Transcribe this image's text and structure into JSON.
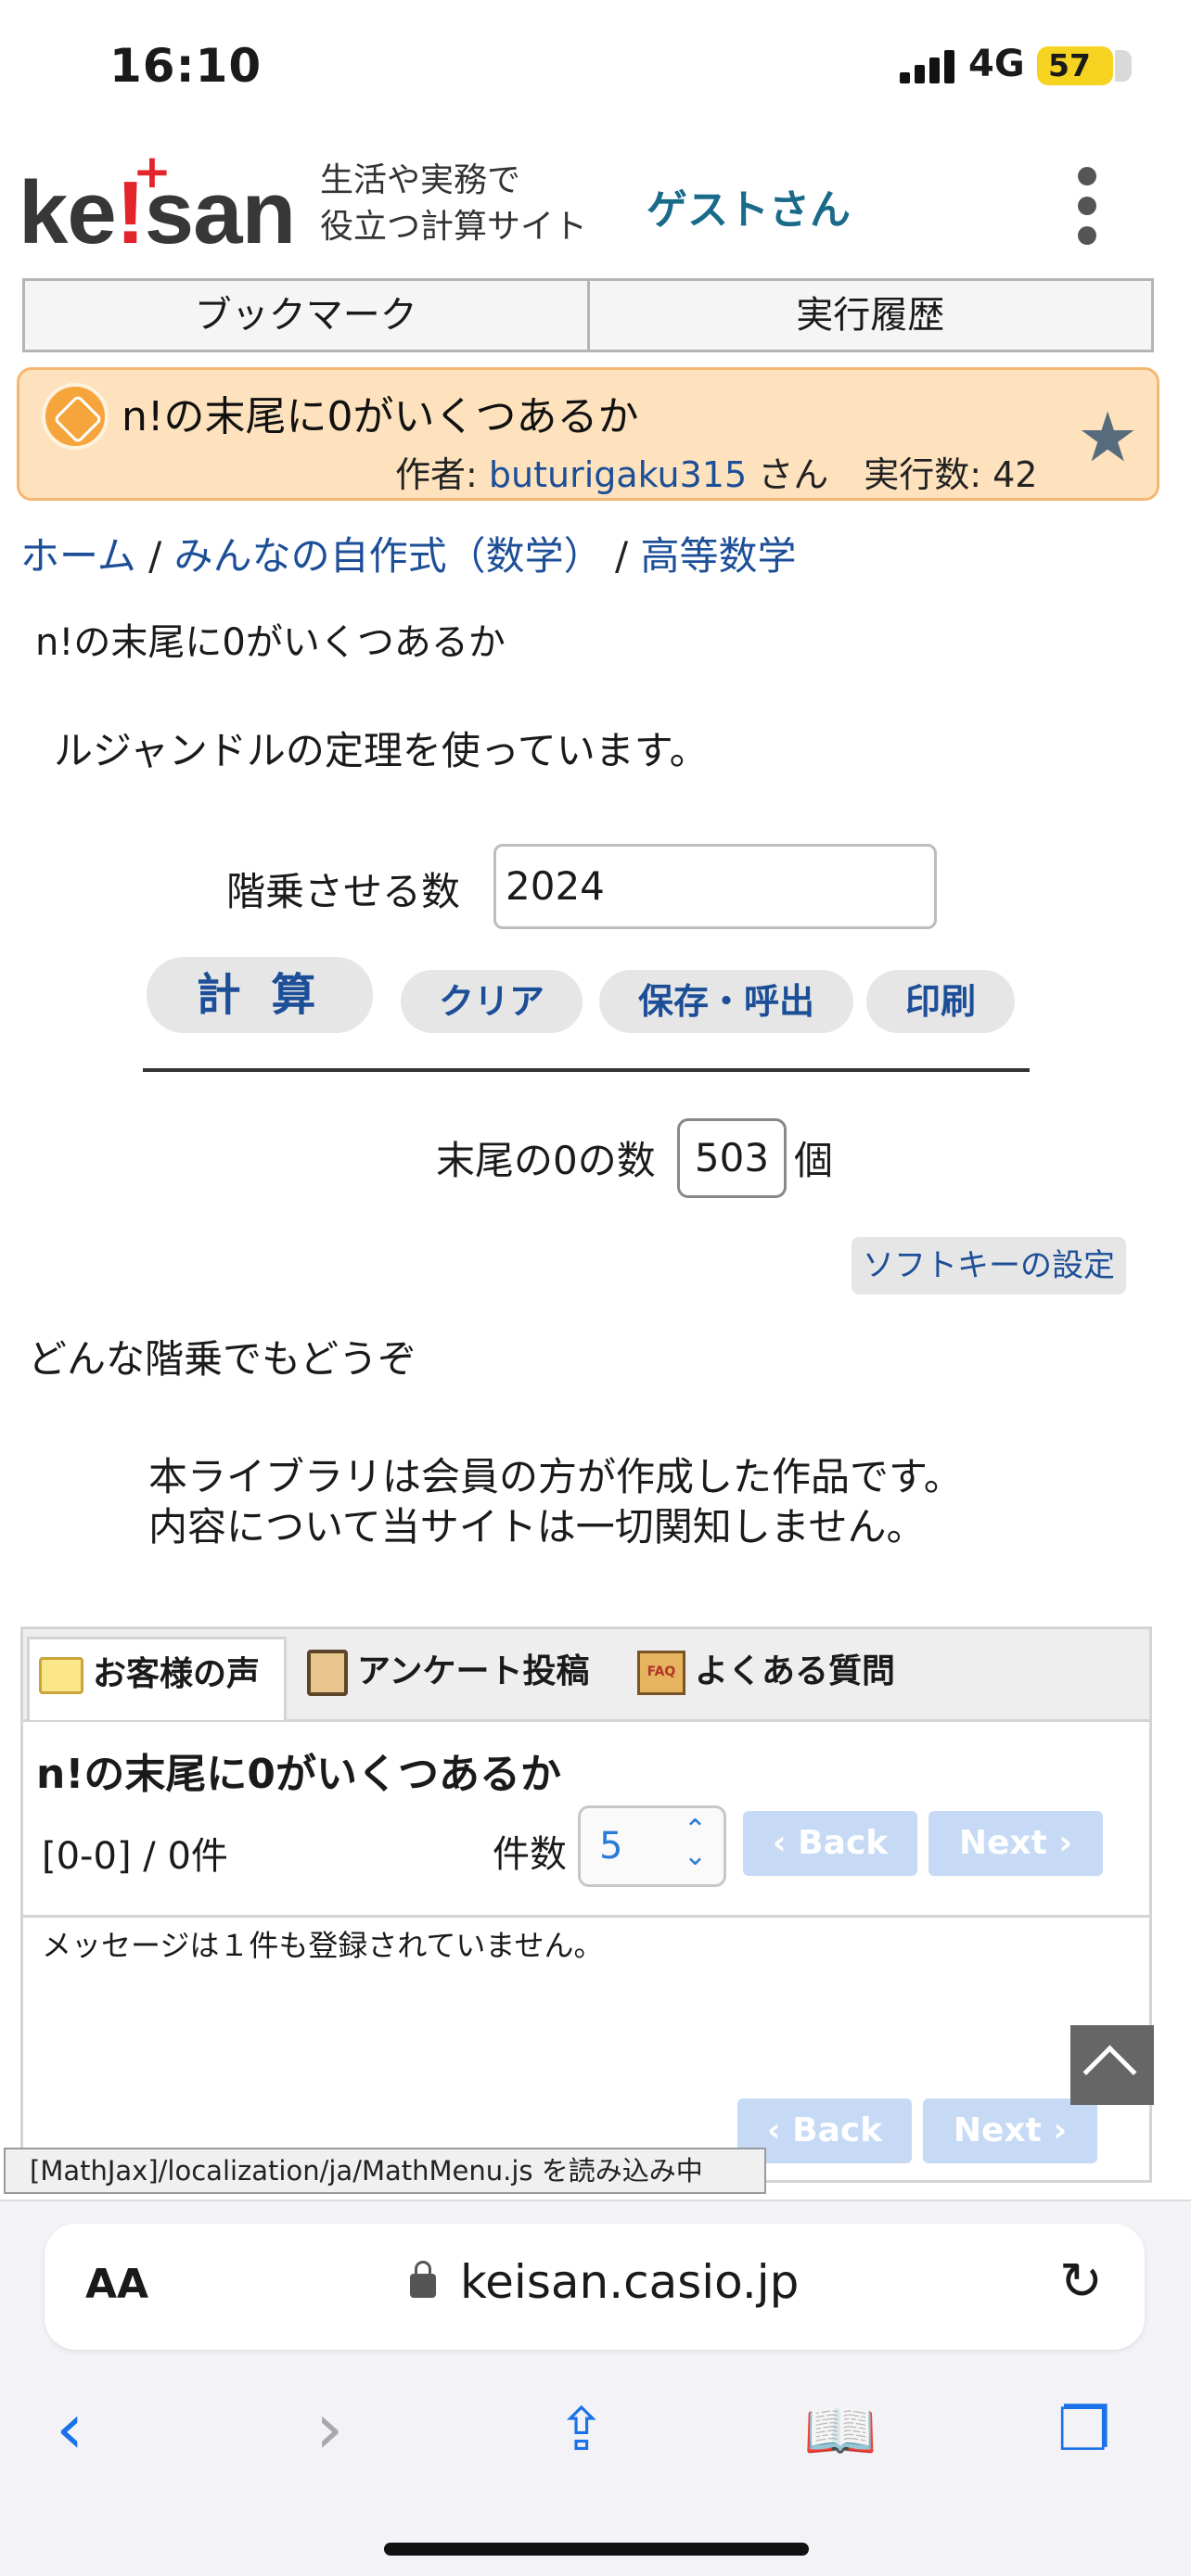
{
  "status_bar": {
    "time": "16:10",
    "network": "4G",
    "battery": "57"
  },
  "header": {
    "logo_prefix": "ke",
    "logo_bang": "!",
    "logo_suffix": "san",
    "tagline_line1": "生活や実務で",
    "tagline_line2": "役立つ計算サイト",
    "guest_label": "ゲストさん"
  },
  "tabs": {
    "bookmark": "ブックマーク",
    "history": "実行履歴"
  },
  "title_card": {
    "title": "n!の末尾に0がいくつあるか",
    "author_prefix": "作者: ",
    "author": "buturigaku315",
    "author_suffix": " さん　実行数: 42"
  },
  "breadcrumb": {
    "home": "ホーム",
    "sep": " / ",
    "category": "みんなの自作式（数学）",
    "subcategory": "高等数学"
  },
  "description": {
    "line1": "n!の末尾に0がいくつあるか",
    "line2": "ルジャンドルの定理を使っています。"
  },
  "calculator": {
    "input_label": "階乗させる数",
    "input_value": "2024",
    "calc_button": "計 算",
    "clear_button": "クリア",
    "save_button": "保存・呼出",
    "print_button": "印刷",
    "result_label": "末尾の0の数",
    "result_value": "503",
    "result_unit": "個",
    "softkey_button": "ソフトキーの設定"
  },
  "note": "どんな階乗でもどうぞ",
  "disclaimer": {
    "line1": "本ライブラリは会員の方が作成した作品です。",
    "line2": "内容について当サイトは一切関知しません。"
  },
  "comments": {
    "tab_voice": "お客様の声",
    "tab_survey": "アンケート投稿",
    "tab_faq": "よくある質問",
    "faq_icon_text": "FAQ",
    "title": "n!の末尾に0がいくつあるか",
    "range": "[0-0] / 0件",
    "count_label": "件数",
    "count_value": "5",
    "back": "‹ Back",
    "next": "Next ›",
    "empty_message": "メッセージは１件も登録されていません。"
  },
  "loading_text": "[MathJax]/localization/ja/MathMenu.js を読み込み中",
  "browser": {
    "aa_label": "AA",
    "domain": "keisan.casio.jp"
  },
  "colors": {
    "accent": "#1d4f98",
    "title_bg": "#fde2bd",
    "logo_red": "#e1252a"
  }
}
